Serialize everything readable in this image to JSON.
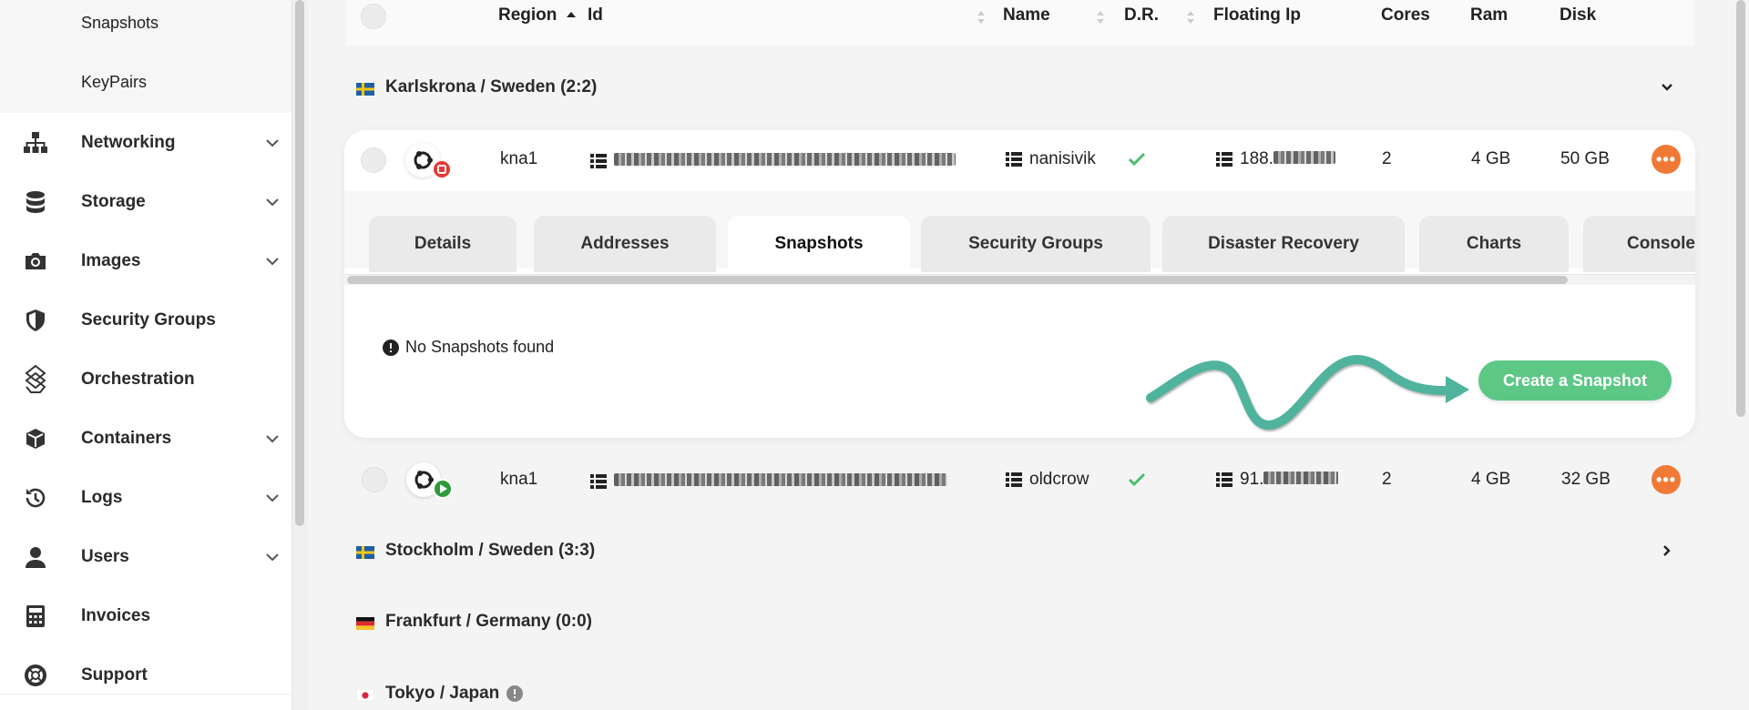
{
  "sidebar": {
    "sub_items": [
      {
        "label": "Snapshots"
      },
      {
        "label": "KeyPairs"
      }
    ],
    "items": [
      {
        "label": "Networking",
        "icon": "sitemap-icon"
      },
      {
        "label": "Storage",
        "icon": "database-icon"
      },
      {
        "label": "Images",
        "icon": "camera-icon"
      },
      {
        "label": "Security Groups",
        "icon": "shield-icon"
      },
      {
        "label": "Orchestration",
        "icon": "orchestration-icon"
      },
      {
        "label": "Containers",
        "icon": "cube-icon"
      },
      {
        "label": "Logs",
        "icon": "history-icon"
      },
      {
        "label": "Users",
        "icon": "user-icon"
      },
      {
        "label": "Invoices",
        "icon": "calculator-icon"
      },
      {
        "label": "Support",
        "icon": "lifebuoy-icon"
      }
    ]
  },
  "table": {
    "columns": {
      "region": "Region",
      "id": "Id",
      "name": "Name",
      "dr": "D.R.",
      "floating_ip": "Floating Ip",
      "cores": "Cores",
      "ram": "Ram",
      "disk": "Disk"
    }
  },
  "regions": [
    {
      "label": "Karlskrona / Sweden (2:2)",
      "flag": "sweden"
    },
    {
      "label": "Stockholm / Sweden (3:3)",
      "flag": "sweden"
    },
    {
      "label": "Frankfurt / Germany (0:0)",
      "flag": "germany"
    },
    {
      "label": "Tokyo / Japan",
      "flag": "japan"
    }
  ],
  "servers": [
    {
      "region": "kna1",
      "name": "nanisivik",
      "floating_ip": "188.",
      "cores": "2",
      "ram": "4 GB",
      "disk": "50 GB",
      "state": "stopped"
    },
    {
      "region": "kna1",
      "name": "oldcrow",
      "floating_ip": "91.",
      "cores": "2",
      "ram": "4 GB",
      "disk": "32 GB",
      "state": "running"
    }
  ],
  "detail_tabs": [
    {
      "label": "Details"
    },
    {
      "label": "Addresses"
    },
    {
      "label": "Snapshots"
    },
    {
      "label": "Security Groups"
    },
    {
      "label": "Disaster Recovery"
    },
    {
      "label": "Charts"
    },
    {
      "label": "Console"
    }
  ],
  "snapshots": {
    "empty_message": "No Snapshots found",
    "create_button": "Create a Snapshot"
  },
  "more_label": "•••",
  "colors": {
    "accent_green": "#5dc786",
    "check_green": "#4cbb74",
    "more_orange": "#f07a35",
    "stopped_red": "#e53935",
    "running_green": "#2e9a3a",
    "arrow_teal": "#4fb39d"
  }
}
